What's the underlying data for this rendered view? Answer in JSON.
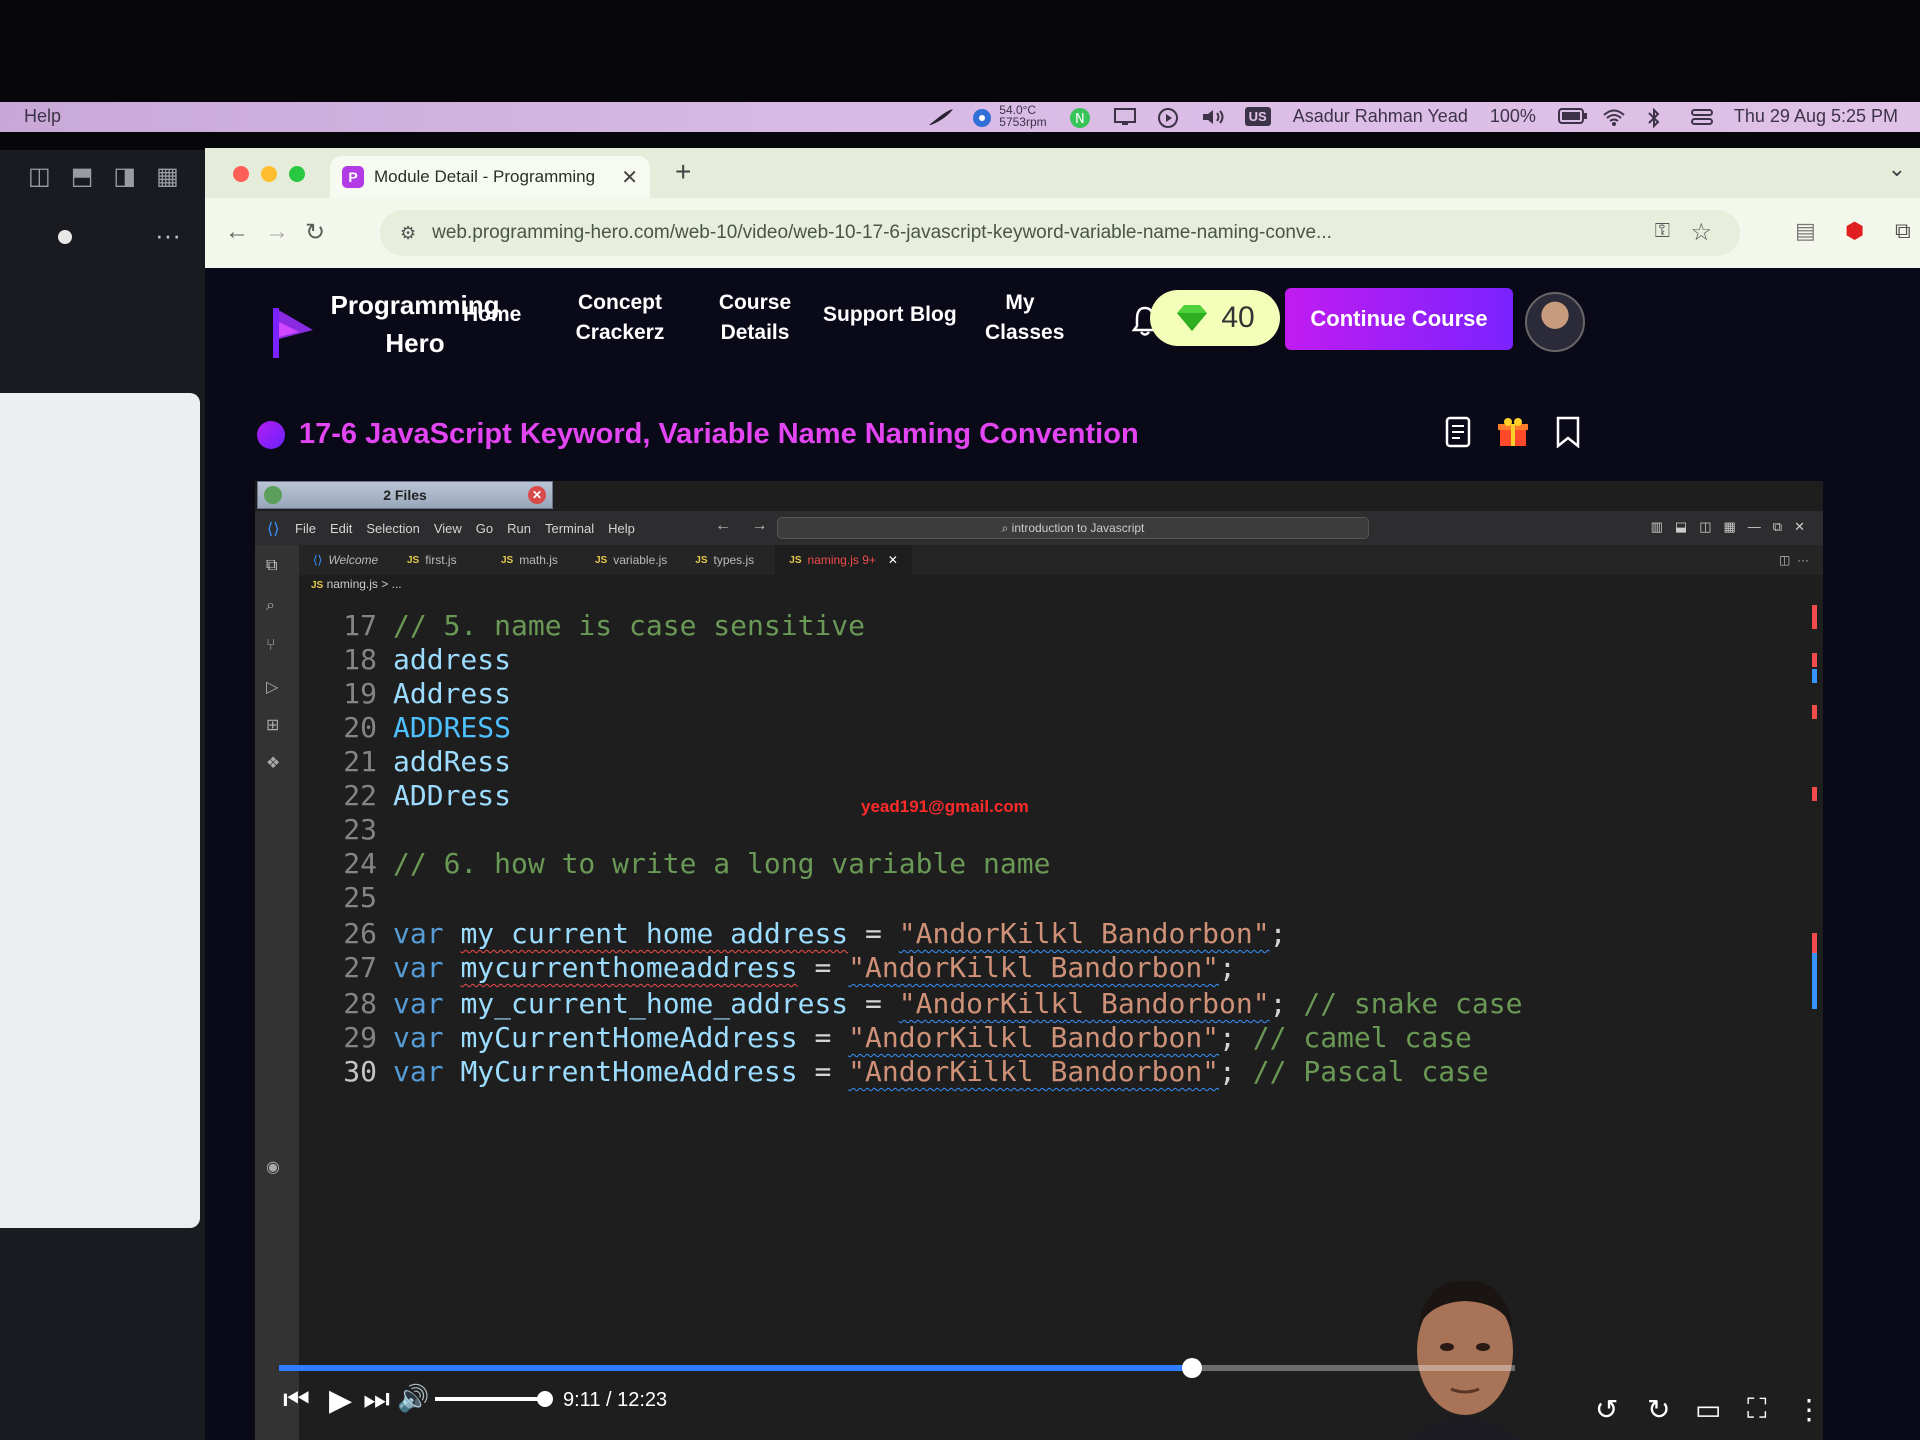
{
  "menubar": {
    "app_menu": "Help",
    "temp": "54.0°C",
    "rpm": "5753rpm",
    "input_source": "US",
    "user": "Asadur Rahman Yead",
    "battery": "100%",
    "datetime": "Thu 29 Aug  5:25 PM"
  },
  "browser": {
    "tab_title": "Module Detail - Programming",
    "url": "web.programming-hero.com/web-10/video/web-10-17-6-javascript-keyword-variable-name-naming-conve..."
  },
  "site": {
    "brand": "Programming Hero",
    "nav": {
      "home": "Home",
      "concept": "Concept Crackerz",
      "course_details": "Course Details",
      "support": "Support",
      "blog": "Blog",
      "my_classes": "My Classes"
    },
    "gems": "40",
    "continue": "Continue Course",
    "module_title": "17-6 JavaScript Keyword, Variable Name Naming Convention"
  },
  "vscode": {
    "files_tab": "2 Files",
    "menu": [
      "File",
      "Edit",
      "Selection",
      "View",
      "Go",
      "Run",
      "Terminal",
      "Help"
    ],
    "command_center": "introduction to Javascript",
    "tabs": [
      "Welcome",
      "first.js",
      "math.js",
      "variable.js",
      "types.js",
      "naming.js 9+"
    ],
    "breadcrumb": "naming.js > ..."
  },
  "code": {
    "line_numbers": [
      "17",
      "18",
      "19",
      "20",
      "21",
      "22",
      "23",
      "24",
      "25",
      "26",
      "27",
      "28",
      "29",
      "30"
    ],
    "l17": "// 5. name is case sensitive",
    "l18": "address",
    "l19": "Address",
    "l20": "ADDRESS",
    "l21": "addRess",
    "l22": "ADDress",
    "l24": "// 6. how to write a long variable name",
    "var": "var",
    "l26_name": "my current home address",
    "l27_name": "mycurrenthomeaddress",
    "l28_name": "my_current_home_address",
    "l29_name": "myCurrentHomeAddress",
    "l30_name": "MyCurrentHomeAddress",
    "string": "\"AndorKilkl Bandorbon\"",
    "snake": "// snake case",
    "camel": "// camel case",
    "pascal": "// Pascal case"
  },
  "watermark_email": "yead191@gmail.com",
  "player": {
    "time": "9:11 / 12:23",
    "progress_fraction": 0.739
  },
  "colors": {
    "accent": "#c11cf0",
    "progress": "#2f7dff"
  }
}
